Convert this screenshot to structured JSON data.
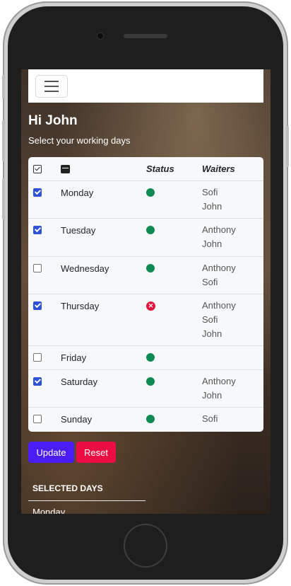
{
  "header": {
    "greeting": "Hi John",
    "subtitle": "Select your working days"
  },
  "table": {
    "columns": {
      "status": "Status",
      "waiters": "Waiters"
    },
    "rows": [
      {
        "day": "Monday",
        "checked": true,
        "status": "ok",
        "waiters": [
          "Sofi",
          "John"
        ]
      },
      {
        "day": "Tuesday",
        "checked": true,
        "status": "ok",
        "waiters": [
          "Anthony",
          "John"
        ]
      },
      {
        "day": "Wednesday",
        "checked": false,
        "status": "ok",
        "waiters": [
          "Anthony",
          "Sofi"
        ]
      },
      {
        "day": "Thursday",
        "checked": true,
        "status": "error",
        "waiters": [
          "Anthony",
          "Sofi",
          "John"
        ]
      },
      {
        "day": "Friday",
        "checked": false,
        "status": "ok",
        "waiters": []
      },
      {
        "day": "Saturday",
        "checked": true,
        "status": "ok",
        "waiters": [
          "Anthony",
          "John"
        ]
      },
      {
        "day": "Sunday",
        "checked": false,
        "status": "ok",
        "waiters": [
          "Sofi"
        ]
      }
    ]
  },
  "actions": {
    "update_label": "Update",
    "reset_label": "Reset"
  },
  "selected": {
    "title": "SELECTED DAYS",
    "first_item": "Monday"
  },
  "icons": {
    "menu": "hamburger-icon",
    "check_header": "checkbox-icon",
    "calendar": "calendar-icon",
    "status_ok": "green-dot-icon",
    "status_error": "red-x-circle-icon"
  },
  "colors": {
    "update": "#4a1df5",
    "reset": "#eb0d43",
    "status_ok": "#0f8a54",
    "status_error": "#e0163e",
    "checkbox": "#2f52d4"
  }
}
